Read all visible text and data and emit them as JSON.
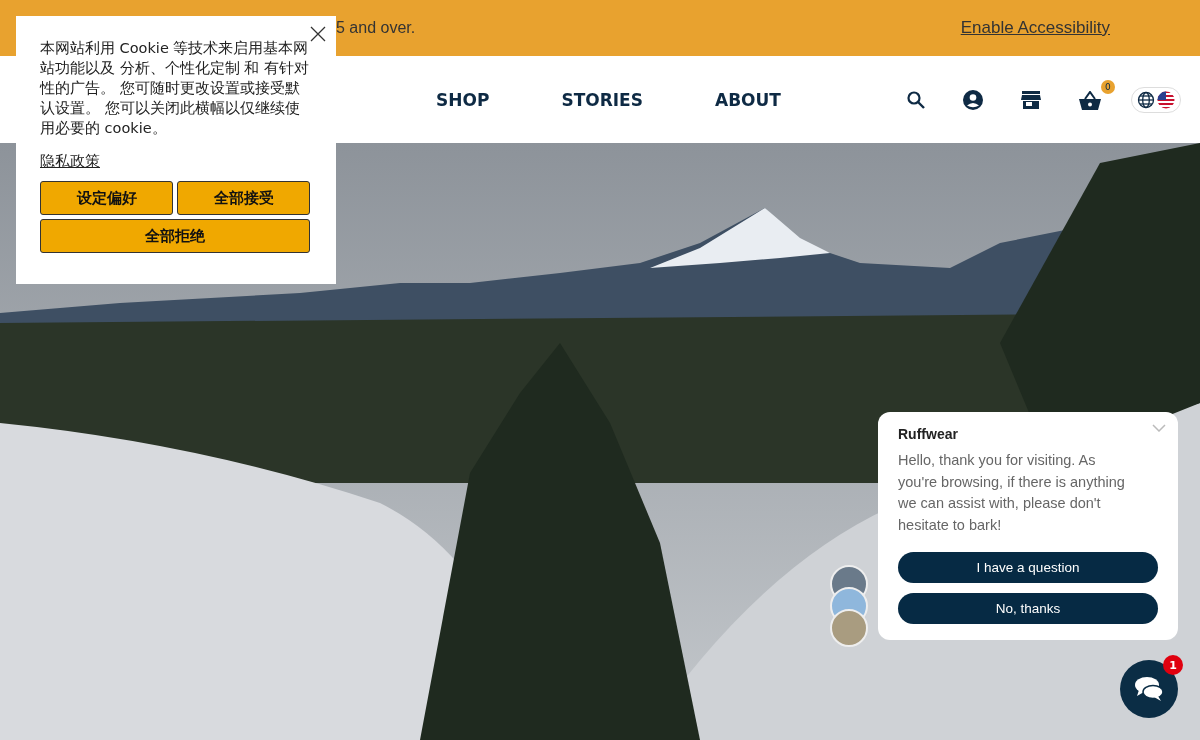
{
  "top_bar": {
    "message": "5 and over.",
    "link": "Enable Accessibility"
  },
  "nav": {
    "items": [
      {
        "label": "SHOP"
      },
      {
        "label": "STORIES"
      },
      {
        "label": "ABOUT"
      }
    ],
    "cart_count": "0"
  },
  "cookie_banner": {
    "text": "本网站利用 Cookie 等技术来启用基本网站功能以及 分析、个性化定制 和 有针对性的广告。 您可随时更改设置或接受默认设置。 您可以关闭此横幅以仅继续使用必要的 cookie。",
    "privacy_link": "隐私政策",
    "buttons": [
      {
        "label": "设定偏好",
        "wide": false
      },
      {
        "label": "全部接受",
        "wide": false
      },
      {
        "label": "全部拒绝",
        "wide": true
      }
    ]
  },
  "chat": {
    "title": "Ruffwear",
    "message": "Hello, thank you for visiting. As you're browsing, if there is anything we can assist with, please don't hesitate to bark!",
    "buttons": [
      "I have a question",
      "No, thanks"
    ],
    "badge": "1"
  }
}
